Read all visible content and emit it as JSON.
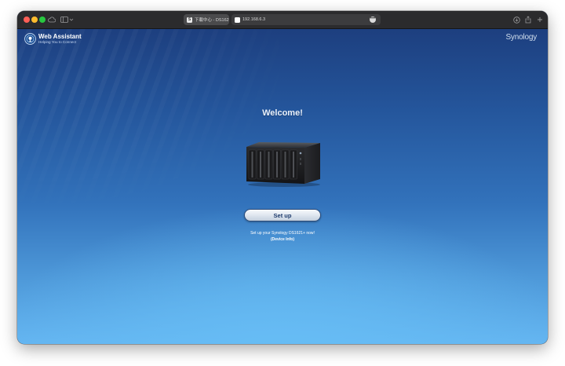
{
  "browser": {
    "tabs": [
      {
        "label": "下載中心 - DS162…",
        "favicon": "S"
      },
      {
        "label": "192.168.6.3"
      }
    ],
    "tab_more_glyph": "•••",
    "icons": [
      "sidebar-toggle-icon",
      "cloud-icon",
      "download-icon",
      "share-icon",
      "new-tab-icon"
    ]
  },
  "header": {
    "app_title": "Web Assistant",
    "app_subtitle": "Helping You to Connect",
    "brand": "Synology"
  },
  "main": {
    "welcome": "Welcome!",
    "setup_button_label": "Set up",
    "setup_text": "Set up your Synology DS1621+ now!",
    "device_info_label": "(Device Info)"
  },
  "colors": {
    "background_top": "#1d3f7f",
    "background_bottom": "#64b5f1",
    "button_text": "#1d3b6c"
  }
}
